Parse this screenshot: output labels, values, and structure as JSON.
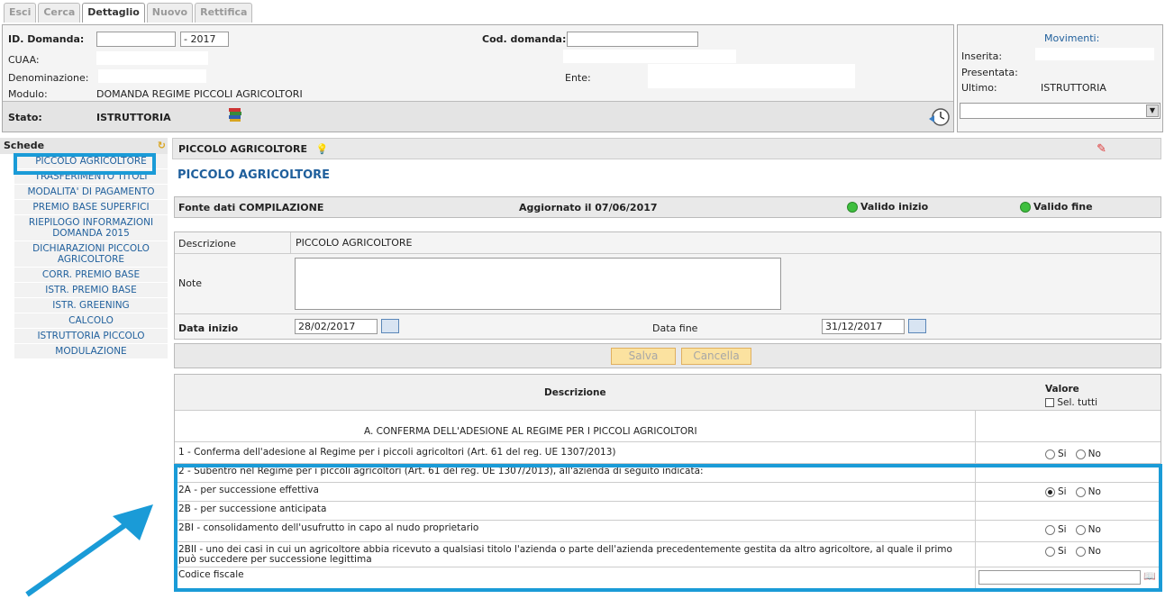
{
  "tabs": [
    "Esci",
    "Cerca",
    "Dettaglio",
    "Nuovo",
    "Rettifica"
  ],
  "header": {
    "id_label": "ID. Domanda:",
    "id_year": "2017",
    "cod_label": "Cod. domanda:",
    "cuaa_label": "CUAA:",
    "denominazione_label": "Denominazione:",
    "ente_label": "Ente:",
    "modulo_label": "Modulo:",
    "modulo_value": "DOMANDA REGIME PICCOLI AGRICOLTORI",
    "stato_label": "Stato:",
    "stato_value": "ISTRUTTORIA"
  },
  "movimenti": {
    "title": "Movimenti:",
    "inserita_label": "Inserita:",
    "presentata_label": "Presentata:",
    "ultimo_label": "Ultimo:",
    "ultimo_value": "ISTRUTTORIA"
  },
  "sidebar": {
    "title": "Schede",
    "items": [
      "PICCOLO AGRICOLTORE",
      "TRASFERIMENTO TITOLI",
      "MODALITA' DI PAGAMENTO",
      "PREMIO BASE SUPERFICI",
      "RIEPILOGO INFORMAZIONI DOMANDA 2015",
      "DICHIARAZIONI PICCOLO AGRICOLTORE",
      "CORR. PREMIO BASE",
      "ISTR. PREMIO BASE",
      "ISTR. GREENING",
      "CALCOLO",
      "ISTRUTTORIA PICCOLO",
      "MODULAZIONE"
    ]
  },
  "main": {
    "head_title": "PICCOLO AGRICOLTORE",
    "section_title": "PICCOLO AGRICOLTORE",
    "fonte": "Fonte dati COMPILAZIONE",
    "aggiornato": "Aggiornato il 07/06/2017",
    "valido_inizio": "Valido inizio",
    "valido_fine": "Valido fine",
    "descrizione_label": "Descrizione",
    "descrizione_value": "PICCOLO AGRICOLTORE",
    "note_label": "Note",
    "data_inizio_label": "Data inizio",
    "data_inizio_value": "28/02/2017",
    "data_fine_label": "Data fine",
    "data_fine_value": "31/12/2017",
    "salva": "Salva",
    "cancella": "Cancella"
  },
  "grid": {
    "col_descrizione": "Descrizione",
    "col_valore": "Valore",
    "sel_tutti": "Sel. tutti",
    "section_a": "A. CONFERMA DELL'ADESIONE AL REGIME PER I PICCOLI AGRICOLTORI",
    "rows": [
      {
        "text": "1 - Conferma dell'adesione al Regime per i piccoli agricoltori (Art. 61 del reg. UE 1307/2013)"
      },
      {
        "text": "2 - Subentro nel Regime per i piccoli agricoltori (Art. 61 del reg. UE 1307/2013), all'azienda di seguito indicata:"
      },
      {
        "text": "2A - per successione effettiva"
      },
      {
        "text": "2B - per successione anticipata"
      },
      {
        "text": "2BI - consolidamento dell'usufrutto in capo al nudo proprietario"
      },
      {
        "text": "2BII - uno dei casi in cui un agricoltore abbia ricevuto a qualsiasi titolo l'azienda o parte dell'azienda precedentemente gestita da altro agricoltore, al quale il primo può succedere per successione legittima"
      },
      {
        "text": "Codice fiscale"
      }
    ],
    "si": "Si",
    "no": "No"
  }
}
